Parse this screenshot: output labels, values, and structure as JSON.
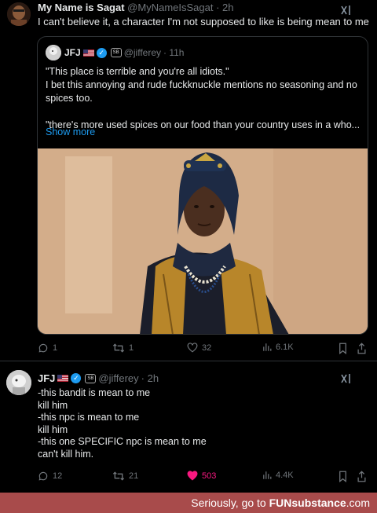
{
  "tweet": {
    "author_name": "My Name is Sagat",
    "author_handle": "@MyNameIsSagat",
    "time": "· 2h",
    "text": "I can't believe it, a character I'm not supposed to like is being mean to me"
  },
  "quote": {
    "author_name": "JFJ",
    "author_handle": "@jifferey",
    "time": "· 11h",
    "badge_label": "SB",
    "lines": [
      "\"This place is terrible and you're all idiots.\"",
      "I bet this annoying and rude fuckknuckle mentions no seasoning and no",
      "spices too.",
      "",
      "\"there's more used spices on our food than your country uses in a who..."
    ],
    "show_more": "Show more"
  },
  "tweet_actions": {
    "replies": "1",
    "retweets": "1",
    "likes": "32",
    "views": "6.1K"
  },
  "reply": {
    "author_name": "JFJ",
    "author_handle": "@jifferey",
    "time": "· 2h",
    "badge_label": "SB",
    "lines": [
      "-this bandit is mean to me",
      "kill him",
      "-this npc is mean to me",
      "kill him",
      "-this one SPECIFIC npc is mean to me",
      "can't kill him."
    ]
  },
  "reply_actions": {
    "replies": "12",
    "retweets": "21",
    "likes": "503",
    "views": "4.4K"
  },
  "footer": {
    "prefix": "Seriously, go to",
    "brand": "FUNsubstance",
    "suffix": ".com"
  },
  "colors": {
    "background": "#000000",
    "text": "#e7e9ea",
    "muted": "#71767b",
    "link": "#1d9bf0",
    "like": "#f91880",
    "footer_bg": "#a84b4b"
  }
}
